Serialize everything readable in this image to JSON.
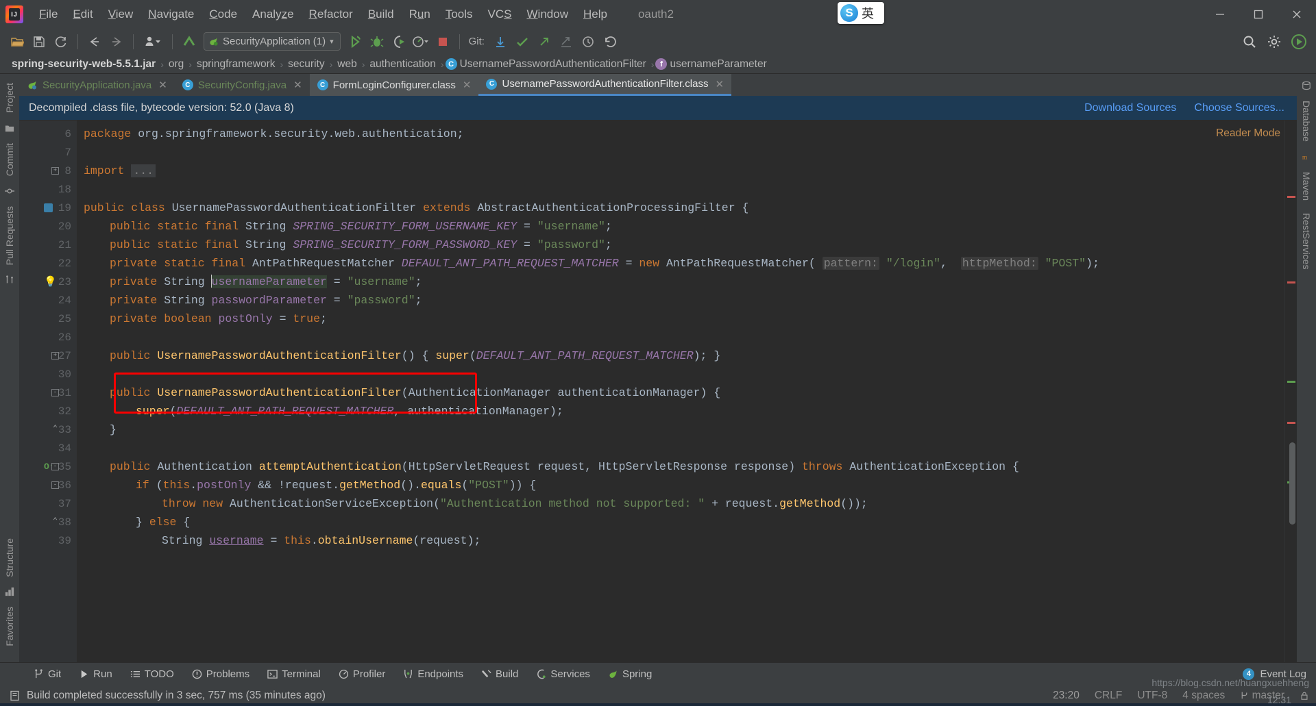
{
  "window": {
    "title": "oauth2",
    "ime": {
      "lang_badge": "英",
      "engine_icon": "sogou-icon"
    },
    "controls": {
      "minimize": "—",
      "maximize": "❐",
      "close": "✕"
    }
  },
  "menubar": {
    "items": [
      {
        "label": "File",
        "mnemonic": "F"
      },
      {
        "label": "Edit",
        "mnemonic": "E"
      },
      {
        "label": "View",
        "mnemonic": "V"
      },
      {
        "label": "Navigate",
        "mnemonic": "N"
      },
      {
        "label": "Code",
        "mnemonic": "C"
      },
      {
        "label": "Analyze",
        "mnemonic": "z"
      },
      {
        "label": "Refactor",
        "mnemonic": "R"
      },
      {
        "label": "Build",
        "mnemonic": "B"
      },
      {
        "label": "Run",
        "mnemonic": "u"
      },
      {
        "label": "Tools",
        "mnemonic": "T"
      },
      {
        "label": "VCS",
        "mnemonic": "S"
      },
      {
        "label": "Window",
        "mnemonic": "W"
      },
      {
        "label": "Help",
        "mnemonic": "H"
      }
    ]
  },
  "toolbar": {
    "open_icon": "open-folder-icon",
    "save_icon": "save-icon",
    "sync_icon": "refresh-icon",
    "back_icon": "arrow-left-icon",
    "forward_icon": "arrow-right-icon",
    "profile_icon": "user-dropdown-icon",
    "checkmark_icon": "update-project-icon",
    "run_config": {
      "label": "SecurityApplication (1)",
      "icon": "spring-leaf-icon",
      "chevron": "▾"
    },
    "run_icon": "run-icon",
    "debug_icon": "debug-icon",
    "run_coverage_icon": "run-with-coverage-icon",
    "profiler_icon": "profiler-dropdown-icon",
    "stop_icon": "stop-icon",
    "git_label": "Git:",
    "git_update_icon": "git-update-icon",
    "git_commit_icon": "git-commit-icon",
    "git_push_icon": "git-push-icon",
    "git_shelve_icon": "git-shelve-icon",
    "git_history_icon": "git-history-icon",
    "git_revert_icon": "git-rollback-icon",
    "search_icon": "search-everywhere-icon",
    "settings_icon": "gear-icon",
    "ide_icon": "intellij-idea-icon"
  },
  "breadcrumb": {
    "items": [
      {
        "label": "spring-security-web-5.5.1.jar",
        "icon": null,
        "bold": true
      },
      {
        "label": "org",
        "icon": null
      },
      {
        "label": "springframework",
        "icon": null
      },
      {
        "label": "security",
        "icon": null
      },
      {
        "label": "web",
        "icon": null
      },
      {
        "label": "authentication",
        "icon": null
      },
      {
        "label": "UsernamePasswordAuthenticationFilter",
        "icon": "class-icon"
      },
      {
        "label": "usernameParameter",
        "icon": "field-icon"
      }
    ],
    "separator": "›"
  },
  "tabs": [
    {
      "label": "SecurityApplication.java",
      "icon": "spring-boot-class-icon",
      "active": false,
      "closable": true
    },
    {
      "label": "SecurityConfig.java",
      "icon": "java-class-icon",
      "active": false,
      "closable": true
    },
    {
      "label": "FormLoginConfigurer.class",
      "icon": "decompiled-class-icon",
      "active": false,
      "closable": true
    },
    {
      "label": "UsernamePasswordAuthenticationFilter.class",
      "icon": "decompiled-class-icon",
      "active": true,
      "closable": true
    }
  ],
  "notification": {
    "message": "Decompiled .class file, bytecode version: 52.0 (Java 8)",
    "links": [
      "Download Sources",
      "Choose Sources..."
    ]
  },
  "editor": {
    "reader_mode_label": "Reader Mode",
    "lines": [
      {
        "num": "6",
        "html": "<span class=\"k\">package</span> <span class=\"t\">org.springframework.security.web.authentication</span><span class=\"t\">;</span>",
        "indent": 0
      },
      {
        "num": "7",
        "html": "",
        "indent": 0
      },
      {
        "num": "8",
        "html": "<span class=\"k\">import</span> <span class=\"imp-dots\">...</span>",
        "indent": 0,
        "fold": "+"
      },
      {
        "num": "18",
        "html": "",
        "indent": 0
      },
      {
        "num": "19",
        "html": "<span class=\"k\">public class</span> <span class=\"t\">UsernamePasswordAuthenticationFilter</span> <span class=\"k\">extends</span> <span class=\"t\">AbstractAuthenticationProcessingFilter</span> <span class=\"t\">{</span>",
        "indent": 0
      },
      {
        "num": "20",
        "html": "<span class=\"k\">public static final</span> <span class=\"t\">String</span> <span class=\"cf\">SPRING_SECURITY_FORM_USERNAME_KEY</span> <span class=\"t\">=</span> <span class=\"s\">\"username\"</span><span class=\"t\">;</span>",
        "indent": 1
      },
      {
        "num": "21",
        "html": "<span class=\"k\">public static final</span> <span class=\"t\">String</span> <span class=\"cf\">SPRING_SECURITY_FORM_PASSWORD_KEY</span> <span class=\"t\">=</span> <span class=\"s\">\"password\"</span><span class=\"t\">;</span>",
        "indent": 1
      },
      {
        "num": "22",
        "html": "<span class=\"k\">private static final</span> <span class=\"t\">AntPathRequestMatcher</span> <span class=\"cf\">DEFAULT_ANT_PATH_REQUEST_MATCHER</span> <span class=\"t\">=</span> <span class=\"k\">new</span> <span class=\"t\">AntPathRequestMatcher(</span> <span class=\"hint\">pattern:</span> <span class=\"s\">\"/login\"</span><span class=\"t\">,</span>  <span class=\"hint\">httpMethod:</span> <span class=\"s\">\"POST\"</span><span class=\"t\">);</span>",
        "indent": 1
      },
      {
        "num": "23",
        "html": "<span class=\"k\">private</span> <span class=\"t\">String</span> <span class=\"caret\"></span><span class=\"fl fieldhl\">usernameParameter</span> <span class=\"t\">=</span> <span class=\"s\">\"username\"</span><span class=\"t\">;</span>",
        "indent": 1,
        "bulb": true
      },
      {
        "num": "24",
        "html": "<span class=\"k\">private</span> <span class=\"t\">String</span> <span class=\"fl\">passwordParameter</span> <span class=\"t\">=</span> <span class=\"s\">\"password\"</span><span class=\"t\">;</span>",
        "indent": 1
      },
      {
        "num": "25",
        "html": "<span class=\"k\">private boolean</span> <span class=\"fl\">postOnly</span> <span class=\"t\">=</span> <span class=\"k\">true</span><span class=\"t\">;</span>",
        "indent": 1
      },
      {
        "num": "26",
        "html": "",
        "indent": 0
      },
      {
        "num": "27",
        "html": "<span class=\"k\">public</span> <span class=\"mt\">UsernamePasswordAuthenticationFilter</span><span class=\"t\">()</span> <span class=\"t\">{</span> <span class=\"mt\">super</span><span class=\"t\">(</span><span class=\"cf\">DEFAULT_ANT_PATH_REQUEST_MATCHER</span><span class=\"t\">);</span> <span class=\"t\">}</span>",
        "indent": 1,
        "fold": "+"
      },
      {
        "num": "30",
        "html": "",
        "indent": 0
      },
      {
        "num": "31",
        "html": "<span class=\"k\">public</span> <span class=\"mt\">UsernamePasswordAuthenticationFilter</span><span class=\"t\">(AuthenticationManager authenticationManager)</span> <span class=\"t\">{</span>",
        "indent": 1,
        "fold": "-"
      },
      {
        "num": "32",
        "html": "<span class=\"mt\">super</span><span class=\"t\">(</span><span class=\"cf\">DEFAULT_ANT_PATH_REQUEST_MATCHER</span><span class=\"t\">, authenticationManager);</span>",
        "indent": 2
      },
      {
        "num": "33",
        "html": "<span class=\"t\">}</span>",
        "indent": 1,
        "fold": "^"
      },
      {
        "num": "34",
        "html": "",
        "indent": 0
      },
      {
        "num": "35",
        "html": "<span class=\"k\">public</span> <span class=\"t\">Authentication</span> <span class=\"mt\">attemptAuthentication</span><span class=\"t\">(HttpServletRequest request, HttpServletResponse response)</span> <span class=\"k\">throws</span> <span class=\"t\">AuthenticationException</span> <span class=\"t\">{</span>",
        "indent": 1,
        "fold": "-",
        "override": true
      },
      {
        "num": "36",
        "html": "<span class=\"k\">if</span> <span class=\"t\">(</span><span class=\"k\">this</span><span class=\"t\">.</span><span class=\"fl\">postOnly</span> <span class=\"t\">&amp;&amp; !request.</span><span class=\"mt\">getMethod</span><span class=\"t\">().</span><span class=\"mt\">equals</span><span class=\"t\">(</span><span class=\"s\">\"POST\"</span><span class=\"t\">)) {</span>",
        "indent": 2,
        "fold": "-"
      },
      {
        "num": "37",
        "html": "<span class=\"k\">throw new</span> <span class=\"t\">AuthenticationServiceException(</span><span class=\"s\">\"Authentication method not supported: \"</span> <span class=\"t\">+ request.</span><span class=\"mt\">getMethod</span><span class=\"t\">());</span>",
        "indent": 3
      },
      {
        "num": "38",
        "html": "<span class=\"t\">}</span> <span class=\"k\">else</span> <span class=\"t\">{</span>",
        "indent": 2,
        "fold": "^"
      },
      {
        "num": "39",
        "html": "<span class=\"t\">String </span><span class=\"fl\" style=\"text-decoration:underline\">username</span> <span class=\"t\">=</span> <span class=\"k\">this</span><span class=\"t\">.</span><span class=\"mt\">obtainUsername</span><span class=\"t\">(request);</span>",
        "indent": 3
      }
    ]
  },
  "toolwindows": {
    "left": [
      "Project",
      "Commit",
      "Pull Requests",
      "Structure",
      "Favorites"
    ],
    "right": [
      "Database",
      "Maven",
      "RestServices"
    ]
  },
  "bottombar": {
    "items": [
      {
        "label": "Git",
        "icon": "git-branch-icon"
      },
      {
        "label": "Run",
        "icon": "run-triangle-icon"
      },
      {
        "label": "TODO",
        "icon": "todo-list-icon"
      },
      {
        "label": "Problems",
        "icon": "problems-icon"
      },
      {
        "label": "Terminal",
        "icon": "terminal-icon"
      },
      {
        "label": "Profiler",
        "icon": "profiler-icon"
      },
      {
        "label": "Endpoints",
        "icon": "endpoints-icon"
      },
      {
        "label": "Build",
        "icon": "build-hammer-icon"
      },
      {
        "label": "Services",
        "icon": "services-icon"
      },
      {
        "label": "Spring",
        "icon": "spring-leaf-icon"
      }
    ],
    "event_log": {
      "label": "Event Log",
      "count": "4"
    }
  },
  "statusbar": {
    "message": "Build completed successfully in 3 sec, 757 ms (35 minutes ago)",
    "message_icon": "build-status-icon",
    "time": "23:20",
    "line_separator": "CRLF",
    "encoding": "UTF-8",
    "indent": "4 spaces",
    "branch": "master",
    "branch_icon": "git-branch-icon",
    "lock_icon": "lock-icon"
  },
  "watermarks": {
    "url": "https://blog.csdn.net/huangxuehheng",
    "clock": "12:31"
  }
}
